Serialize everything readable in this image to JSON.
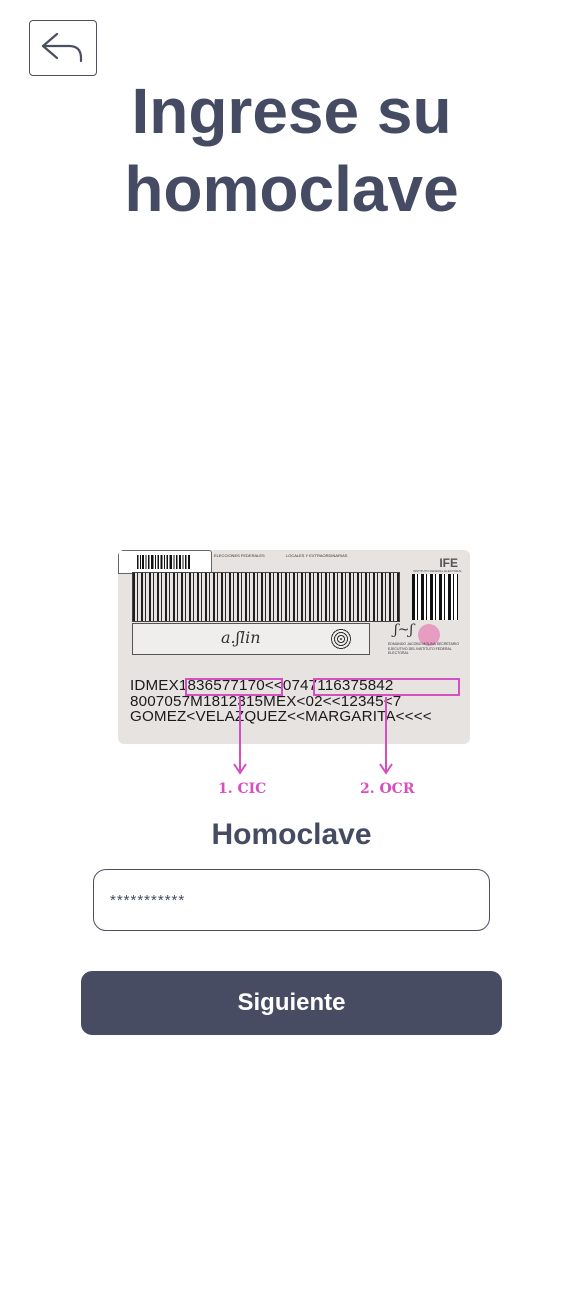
{
  "header": {
    "back_icon": "undo-arrow-icon",
    "title": "Ingrese su\nhomoclave"
  },
  "id_card": {
    "header_labels": [
      "ELECCIONES FEDERALES",
      "LOCALES Y EXTRAORDINARIAS"
    ],
    "logo_text": "IFE",
    "logo_subtext": "INSTITUTO FEDERAL ELECTORAL",
    "secretary_text": "EDMUNDO JACOBO MOLINA SECRETARIO EJECUTIVO DEL INSTITUTO FEDERAL ELECTORAL",
    "mrz_lines": [
      "IDMEX1836577170<<0747116375842",
      "8007057M1812315MEX<02<<12345<7",
      "GOMEZ<VELAZQUEZ<<MARGARITA<<<<"
    ],
    "highlight_color": "#d64fc0"
  },
  "annotations": {
    "cic": "1. CIC",
    "ocr": "2. OCR"
  },
  "form": {
    "label": "Homoclave",
    "input_value": "***********",
    "submit_label": "Siguiente"
  },
  "colors": {
    "primary": "#474c62",
    "text": "#454b63",
    "accent": "#d64fc0"
  }
}
